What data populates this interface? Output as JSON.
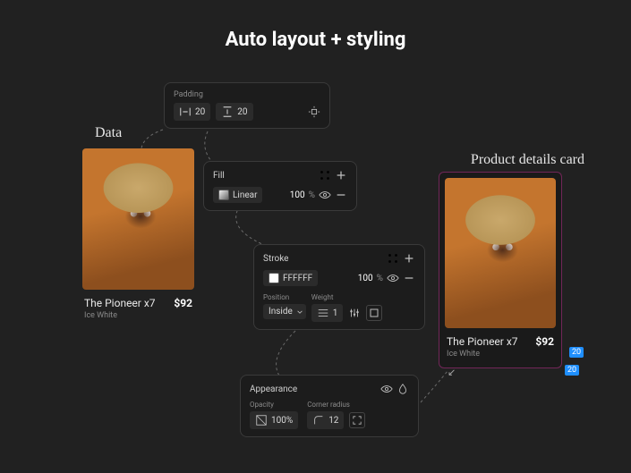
{
  "title": "Auto layout + styling",
  "labels": {
    "data": "Data",
    "product": "Product details card"
  },
  "product": {
    "name": "The Pioneer x7",
    "price": "$92",
    "variant": "Ice White"
  },
  "padding": {
    "title": "Padding",
    "h": "20",
    "v": "20"
  },
  "fill": {
    "title": "Fill",
    "type": "Linear",
    "opacity": "100",
    "pct": "%"
  },
  "stroke": {
    "title": "Stroke",
    "hex": "FFFFFF",
    "opacity": "100",
    "pct": "%",
    "positionLabel": "Position",
    "position": "Inside",
    "weightLabel": "Weight",
    "weight": "1"
  },
  "appearance": {
    "title": "Appearance",
    "opacityLabel": "Opacity",
    "opacity": "100%",
    "radiusLabel": "Corner radius",
    "radius": "12"
  },
  "annotations": {
    "a": "20",
    "b": "20"
  }
}
